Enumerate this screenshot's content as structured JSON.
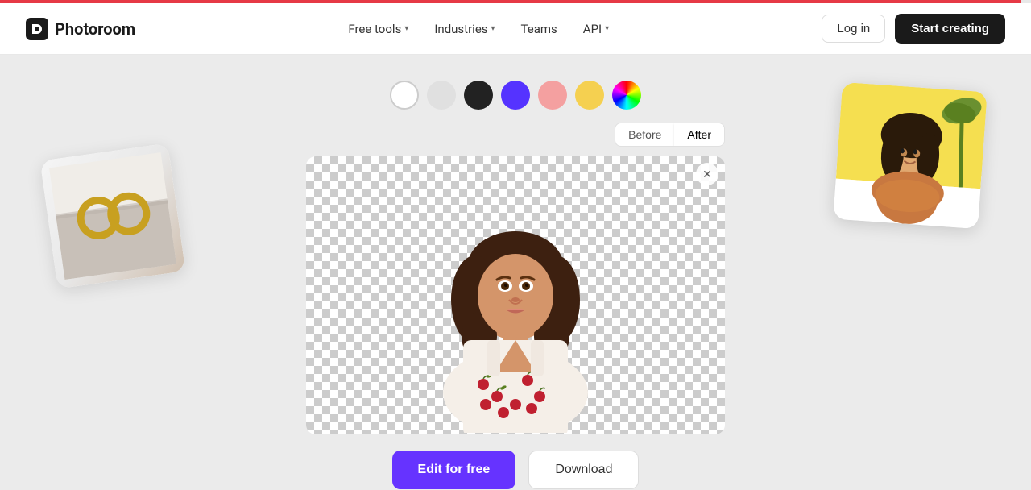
{
  "topbar": {},
  "header": {
    "logo_text": "Photoroom",
    "nav": [
      {
        "label": "Free tools",
        "has_dropdown": true
      },
      {
        "label": "Industries",
        "has_dropdown": true
      },
      {
        "label": "Teams",
        "has_dropdown": false
      },
      {
        "label": "API",
        "has_dropdown": true
      }
    ],
    "login_label": "Log in",
    "start_label": "Start creating"
  },
  "toolbar": {
    "swatches": [
      {
        "id": "white",
        "label": "White",
        "selected": true
      },
      {
        "id": "light-gray",
        "label": "Light gray",
        "selected": false
      },
      {
        "id": "black",
        "label": "Black",
        "selected": false
      },
      {
        "id": "purple",
        "label": "Purple",
        "selected": false
      },
      {
        "id": "pink",
        "label": "Pink",
        "selected": false
      },
      {
        "id": "yellow",
        "label": "Yellow",
        "selected": false
      },
      {
        "id": "multicolor",
        "label": "Custom color",
        "selected": false
      }
    ],
    "before_label": "Before",
    "after_label": "After"
  },
  "cta": {
    "edit_label": "Edit for free",
    "download_label": "Download"
  }
}
